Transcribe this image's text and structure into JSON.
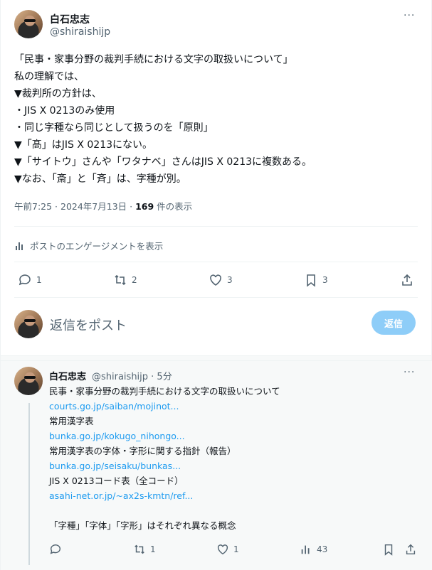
{
  "tweet": {
    "author_name": "白石忠志",
    "handle": "@shiraishijp",
    "more": "···",
    "lines": [
      "「民事・家事分野の裁判手続における文字の取扱いについて」",
      "私の理解では、",
      "▼裁判所の方針は、",
      "・JIS X 0213のみ使用",
      "・同じ字種なら同じとして扱うのを「原則」",
      "▼「髙」はJIS X 0213にない。",
      "▼「サイトウ」さんや「ワタナベ」さんはJIS X 0213に複数ある。",
      "▼なお、「斎」と「斉」は、字種が別。"
    ],
    "meta_time": "午前7:25 · 2024年7月13日 · ",
    "meta_views": "169",
    "meta_views_label": " 件の表示",
    "engagements_label": "ポストのエンゲージメントを表示",
    "actions": {
      "replies": "1",
      "reposts": "2",
      "likes": "3",
      "bookmarks": "3"
    }
  },
  "reply_composer": {
    "placeholder": "返信をポスト",
    "button": "返信"
  },
  "reply": {
    "author_name": "白石忠志",
    "handle_time": "@shiraishijp · 5分",
    "more": "···",
    "lines": [
      {
        "text": "民事・家事分野の裁判手続における文字の取扱いについて",
        "link": false
      },
      {
        "text": "courts.go.jp/saiban/mojinot...",
        "link": true
      },
      {
        "text": "常用漢字表",
        "link": false
      },
      {
        "text": "bunka.go.jp/kokugo_nihongo...",
        "link": true
      },
      {
        "text": "常用漢字表の字体・字形に関する指針（報告）",
        "link": false
      },
      {
        "text": "bunka.go.jp/seisaku/bunkas...",
        "link": true
      },
      {
        "text": "JIS X 0213コード表（全コード）",
        "link": false
      },
      {
        "text": "asahi-net.or.jp/~ax2s-kmtn/ref...",
        "link": true
      },
      {
        "text": "",
        "link": false
      },
      {
        "text": "「字種」「字体」「字形」はそれぞれ異なる概念",
        "link": false
      }
    ],
    "actions": {
      "reposts": "1",
      "likes": "1",
      "views": "43"
    }
  },
  "colors": {
    "accent": "#1d9bf0",
    "muted": "#536471",
    "reply_button": "#8ecdf8"
  }
}
